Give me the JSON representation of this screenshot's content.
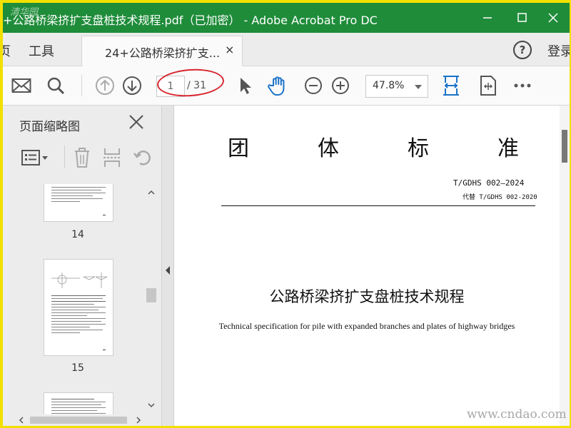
{
  "window": {
    "title": "+公路桥梁挤扩支盘桩技术规程.pdf（已加密） - Adobe Acrobat Pro DC",
    "watermark_logo": "清华园"
  },
  "menu": {
    "home_partial": "页",
    "tools": "工具",
    "tab_label": "24+公路桥梁挤扩支...",
    "tab_close": "×",
    "help": "?",
    "login_partial": "登录"
  },
  "toolbar": {
    "page_current": "1",
    "page_total": "/ 31",
    "zoom": "47.8%"
  },
  "thumbnail_panel": {
    "title": "页面缩略图",
    "pages": [
      {
        "label": "14"
      },
      {
        "label": "15"
      },
      {
        "label": ""
      }
    ]
  },
  "document": {
    "title_chars": [
      "团",
      "体",
      "标",
      "准"
    ],
    "standard_code": "T/GDHS  002—2024",
    "replaces": "代替 T/GDHS 002-2020",
    "title_cn": "公路桥梁挤扩支盘桩技术规程",
    "title_en": "Technical specification for pile with expanded branches and plates of highway bridges"
  },
  "site_watermark": "www.cndao.com",
  "colors": {
    "title_bar": "#1f8c3a",
    "accent_blue": "#1a73c8",
    "annotation_red": "#d8262e",
    "frame_yellow": "#f2e100"
  }
}
